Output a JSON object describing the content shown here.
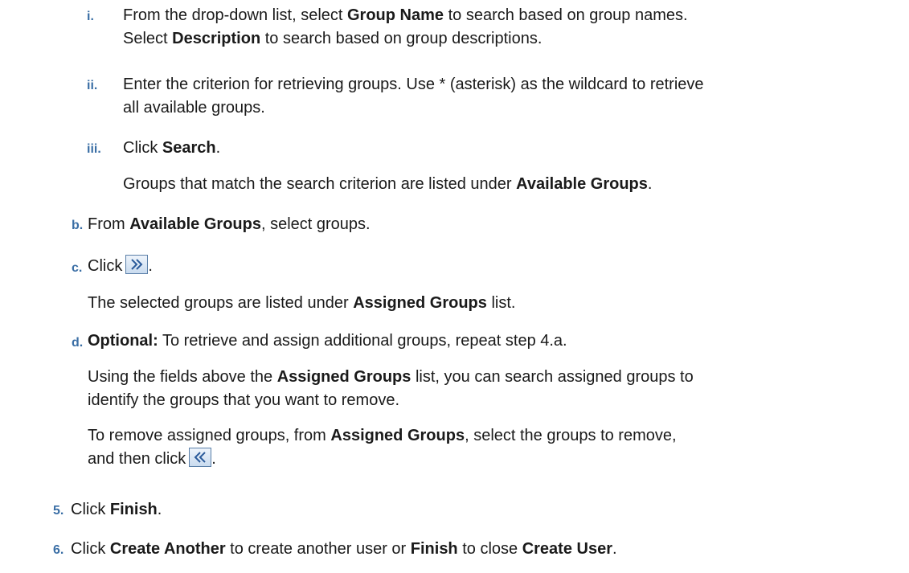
{
  "steps": {
    "i": {
      "num": "i.",
      "l1a": "From the drop-down list, select ",
      "l1b": "Group Name",
      "l1c": " to search based on group names.",
      "l2a": "Select ",
      "l2b": "Description",
      "l2c": " to search based on group descriptions."
    },
    "ii": {
      "num": "ii.",
      "l1": "Enter the criterion for retrieving groups. Use * (asterisk) as the wildcard to retrieve",
      "l2": "all available groups."
    },
    "iii": {
      "num": "iii.",
      "a": "Click ",
      "b": "Search",
      "c": ".",
      "p_a": "Groups that match the search criterion are listed under ",
      "p_b": "Available Groups",
      "p_c": "."
    },
    "b": {
      "num": "b.",
      "a": "From ",
      "b": "Available Groups",
      "c": ", select groups."
    },
    "c": {
      "num": "c.",
      "a": "Click",
      "c": ".",
      "p_a": "The selected groups are listed under ",
      "p_b": "Assigned Groups",
      "p_c": " list."
    },
    "d": {
      "num": "d.",
      "a": "Optional:",
      "b": " To retrieve and assign additional groups, repeat step 4.a.",
      "p1_a": "Using the fields above the ",
      "p1_b": "Assigned Groups",
      "p1_c": " list, you can search assigned groups to",
      "p1_l2": "identify the groups that you want to remove.",
      "p2_a": "To remove assigned groups, from ",
      "p2_b": "Assigned Groups",
      "p2_c": ", select the groups to remove,",
      "p2_l2": "and then click",
      "p2_l2c": "."
    },
    "s5": {
      "num": "5.",
      "a": "Click ",
      "b": "Finish",
      "c": "."
    },
    "s6": {
      "num": "6.",
      "a": "Click ",
      "b": "Create Another",
      "c": " to create another user or ",
      "d": "Finish",
      "e": " to close ",
      "f": "Create User",
      "g": "."
    }
  },
  "icons": {
    "move_right": "move-right-icon",
    "move_left": "move-left-icon"
  }
}
